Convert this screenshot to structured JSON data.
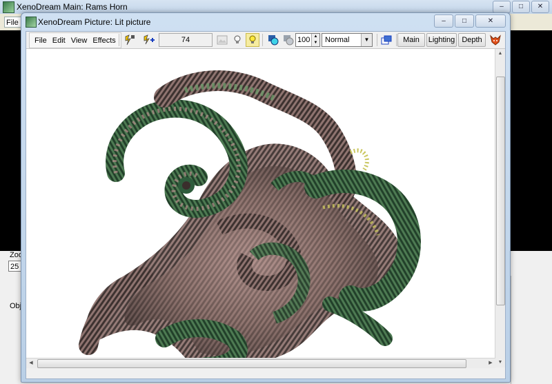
{
  "main_window": {
    "title": "XenoDream Main: Rams Horn",
    "menu_fragment": "File",
    "zoom_label": "Zoom",
    "zoom_value": "25",
    "objects_label": "Obj",
    "controls": {
      "minimize": "–",
      "maximize": "□",
      "close": "✕"
    }
  },
  "picture_window": {
    "title": "XenoDream Picture: Lit picture",
    "controls": {
      "minimize": "–",
      "maximize": "□",
      "close": "✕"
    },
    "menu": [
      "File",
      "Edit",
      "View",
      "Effects"
    ],
    "progress_value": "74",
    "brightness_value": "100",
    "blend_mode": "Normal",
    "tabs": [
      "Main",
      "Lighting",
      "Depth"
    ],
    "canvas_subject": "rams horn fractal render",
    "colors": {
      "fractal_green": "#2e5c3c",
      "fractal_pink": "#b58f8c",
      "fractal_dark": "#3a2e2c",
      "highlight_yellow": "#c9c65e"
    }
  }
}
